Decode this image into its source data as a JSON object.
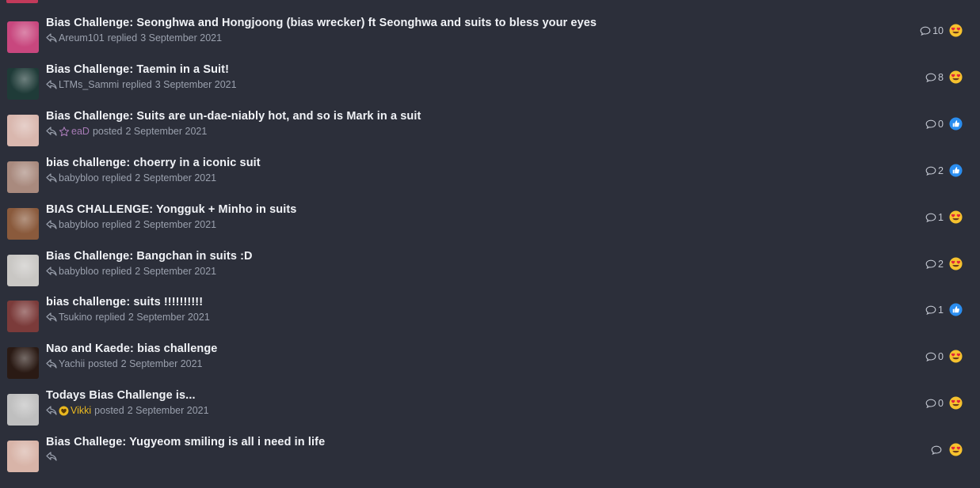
{
  "threads": [
    {
      "title": "Bias Challenge: Seonghwa and Hongjoong (bias wrecker) ft Seonghwa and suits to bless your eyes",
      "user": "Areum101",
      "action": "replied",
      "date": "3 September 2021",
      "replies": "10",
      "reaction": "love",
      "avatar_color": "#c8477e",
      "user_style": "normal",
      "badge": ""
    },
    {
      "title": "Bias Challenge: Taemin in a Suit!",
      "user": "LTMs_Sammi",
      "action": "replied",
      "date": "3 September 2021",
      "replies": "8",
      "reaction": "love",
      "avatar_color": "#1f3b38",
      "user_style": "normal",
      "badge": ""
    },
    {
      "title": "Bias Challenge: Suits are un-dae-niably hot, and so is Mark in a suit",
      "user": "eaD",
      "action": "posted",
      "date": "2 September 2021",
      "replies": "0",
      "reaction": "like",
      "avatar_color": "#d9b7ae",
      "user_style": "purple",
      "badge": "star"
    },
    {
      "title": "bias challenge: choerry in a iconic suit",
      "user": "babybloo",
      "action": "replied",
      "date": "2 September 2021",
      "replies": "2",
      "reaction": "like",
      "avatar_color": "#a98a7e",
      "user_style": "normal",
      "badge": ""
    },
    {
      "title": "BIAS CHALLENGE: Yongguk + Minho in suits",
      "user": "babybloo",
      "action": "replied",
      "date": "2 September 2021",
      "replies": "1",
      "reaction": "love",
      "avatar_color": "#8a5a3c",
      "user_style": "normal",
      "badge": ""
    },
    {
      "title": "Bias Challenge: Bangchan in suits :D",
      "user": "babybloo",
      "action": "replied",
      "date": "2 September 2021",
      "replies": "2",
      "reaction": "love",
      "avatar_color": "#c9c7c4",
      "user_style": "normal",
      "badge": ""
    },
    {
      "title": "bias challenge: suits !!!!!!!!!!",
      "user": "Tsukino",
      "action": "replied",
      "date": "2 September 2021",
      "replies": "1",
      "reaction": "like",
      "avatar_color": "#7b3b3a",
      "user_style": "normal",
      "badge": ""
    },
    {
      "title": "Nao and Kaede: bias challenge",
      "user": "Yachii",
      "action": "posted",
      "date": "2 September 2021",
      "replies": "0",
      "reaction": "love",
      "avatar_color": "#2a1a14",
      "user_style": "normal",
      "badge": ""
    },
    {
      "title": "Todays Bias Challenge is...",
      "user": "Vikki",
      "action": "posted",
      "date": "2 September 2021",
      "replies": "0",
      "reaction": "love",
      "avatar_color": "#bfbfbf",
      "user_style": "gold",
      "badge": "heart"
    },
    {
      "title": "Bias Challege: Yugyeom smiling is all i need in life",
      "user": "",
      "action": "",
      "date": "",
      "replies": "",
      "reaction": "love",
      "avatar_color": "#d8b4a8",
      "user_style": "normal",
      "badge": ""
    }
  ]
}
